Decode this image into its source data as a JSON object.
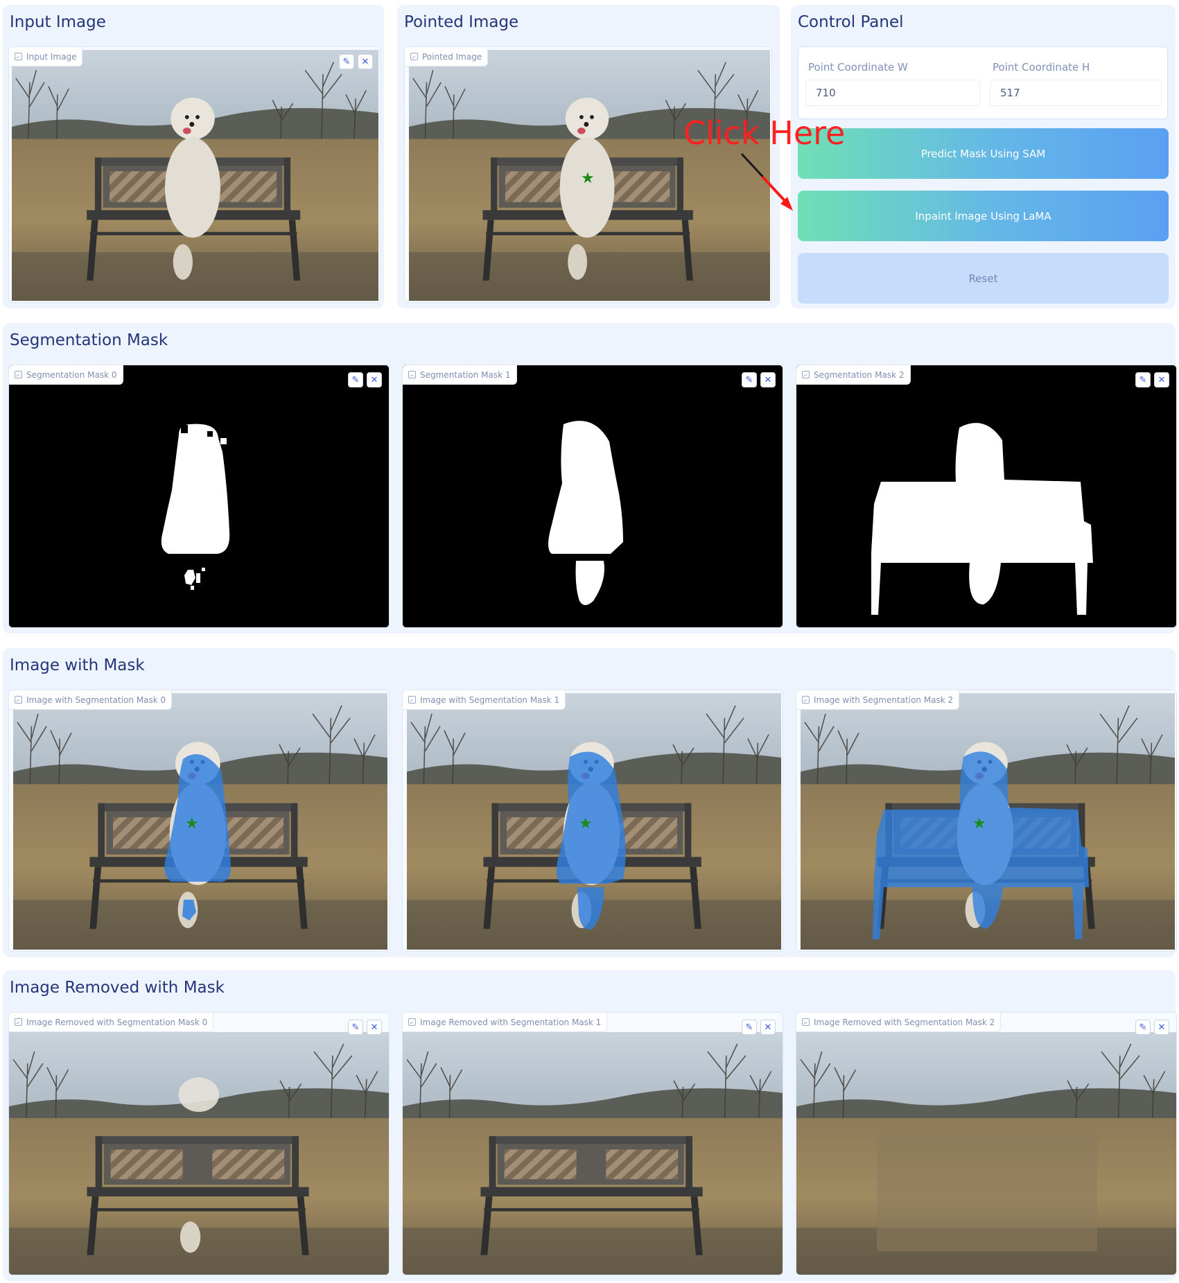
{
  "sections": {
    "input_title": "Input Image",
    "pointed_title": "Pointed Image",
    "control_title": "Control Panel",
    "seg_title": "Segmentation Mask",
    "iwm_title": "Image with Mask",
    "irm_title": "Image Removed with Mask"
  },
  "panels": {
    "input": "Input Image",
    "pointed": "Pointed Image",
    "seg": [
      "Segmentation Mask 0",
      "Segmentation Mask 1",
      "Segmentation Mask 2"
    ],
    "iwm": [
      "Image with Segmentation Mask 0",
      "Image with Segmentation Mask 1",
      "Image with Segmentation Mask 2"
    ],
    "irm": [
      "Image Removed with Segmentation Mask 0",
      "Image Removed with Segmentation Mask 1",
      "Image Removed with Segmentation Mask 2"
    ]
  },
  "control": {
    "coord_w_label": "Point Coordinate W",
    "coord_w_value": "710",
    "coord_h_label": "Point Coordinate H",
    "coord_h_value": "517",
    "predict_button": "Predict Mask Using SAM",
    "inpaint_button": "Inpaint Image Using LaMA",
    "reset_button": "Reset"
  },
  "annotation": {
    "text": "Click Here",
    "color": "#ff2020"
  },
  "icons": {
    "edit": "pencil-icon",
    "clear": "close-icon",
    "image": "image-icon"
  },
  "colors": {
    "mask_overlay": "#2f7fe0",
    "point_marker": "#1a8a1a",
    "title": "#24357a"
  }
}
